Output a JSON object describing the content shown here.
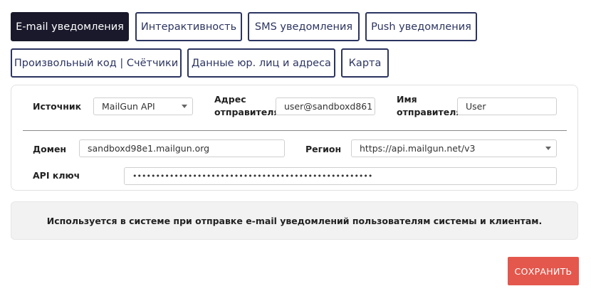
{
  "tabs": [
    {
      "label": "E-mail уведомления"
    },
    {
      "label": "Интерактивность"
    },
    {
      "label": "SMS уведомления"
    },
    {
      "label": "Push уведомления"
    },
    {
      "label": "Произвольный код | Счётчики"
    },
    {
      "label": "Данные юр. лиц и адреса"
    },
    {
      "label": "Карта"
    }
  ],
  "form": {
    "source_label": "Источник",
    "source_value": "MailGun API",
    "sender_address_label_1": "Адрес",
    "sender_address_label_2": "отправителя",
    "sender_address_value": "user@sandboxd861",
    "sender_name_label_1": "Имя",
    "sender_name_label_2": "отправителя",
    "sender_name_value": "User",
    "domain_label": "Домен",
    "domain_value": "sandboxd98e1.mailgun.org",
    "region_label": "Регион",
    "region_value": "https://api.mailgun.net/v3",
    "api_key_label": "API ключ",
    "api_key_value": "••••••••••••••••••••••••••••••••••••••••••••••••••••"
  },
  "info_text": "Используется в системе при отправке e-mail уведомлений пользователям системы и клиентам.",
  "save_label": "СОХРАНИТЬ",
  "colors": {
    "tab_border": "#2c3561",
    "tab_active_bg": "#19192b",
    "save_bg": "#e4574c",
    "info_bg": "#f2f2f2"
  }
}
